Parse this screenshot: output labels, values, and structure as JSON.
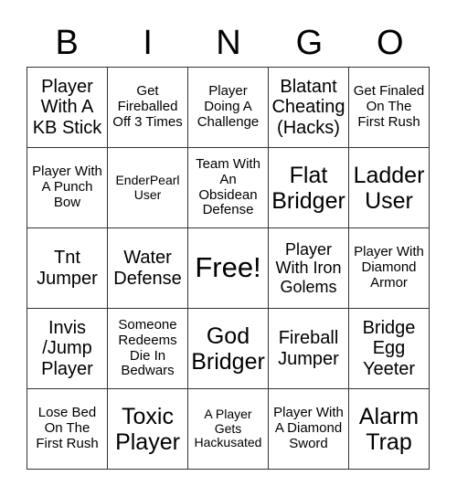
{
  "header": [
    "B",
    "I",
    "N",
    "G",
    "O"
  ],
  "cells": [
    [
      "Player With A KB Stick",
      "Get Fireballed Off 3 Times",
      "Player Doing A Challenge",
      "Blatant Cheating (Hacks)",
      "Get Finaled On The First Rush"
    ],
    [
      "Player With A Punch Bow",
      "EnderPearl User",
      "Team With An Obsidean Defense",
      "Flat Bridger",
      "Ladder User"
    ],
    [
      "Tnt Jumper",
      "Water Defense",
      "Free!",
      "Player With Iron Golems",
      "Player With Diamond Armor"
    ],
    [
      "Invis /Jump Player",
      "Someone Redeems Die In Bedwars",
      "God Bridger",
      "Fireball Jumper",
      "Bridge Egg Yeeter"
    ],
    [
      "Lose Bed On The First Rush",
      "Toxic Player",
      "A Player Gets Hackusated",
      "Player With A Diamond Sword",
      "Alarm Trap"
    ]
  ]
}
